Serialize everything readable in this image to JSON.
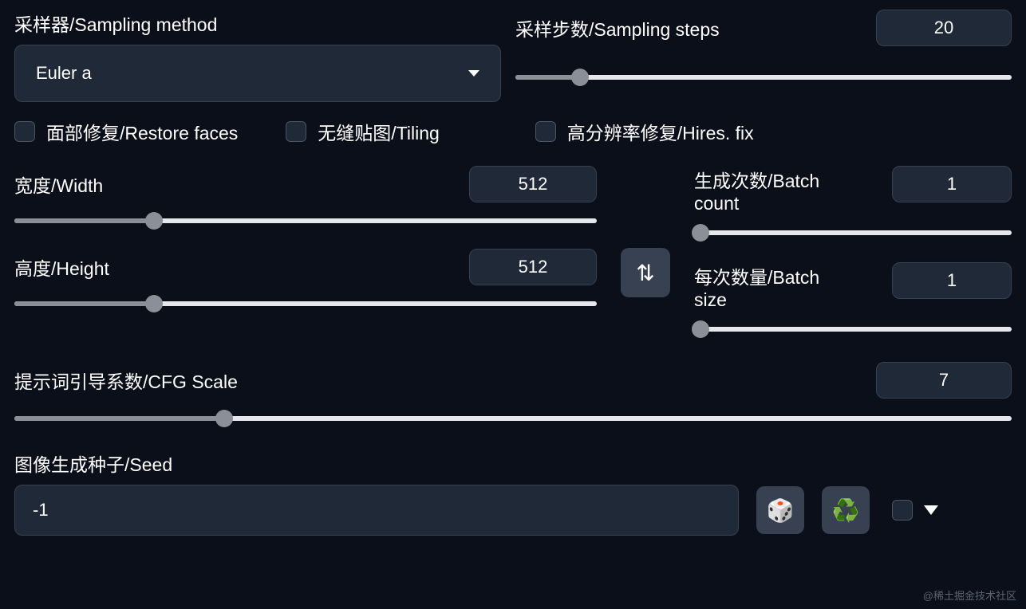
{
  "sampling_method": {
    "label": "采样器/Sampling method",
    "value": "Euler a"
  },
  "sampling_steps": {
    "label": "采样步数/Sampling steps",
    "value": "20",
    "fill_pct": 13
  },
  "restore_faces": {
    "label": "面部修复/Restore faces"
  },
  "tiling": {
    "label": "无缝贴图/Tiling"
  },
  "hires_fix": {
    "label": "高分辨率修复/Hires. fix"
  },
  "width": {
    "label": "宽度/Width",
    "value": "512",
    "fill_pct": 24
  },
  "height": {
    "label": "高度/Height",
    "value": "512",
    "fill_pct": 24
  },
  "batch_count": {
    "label": "生成次数/Batch count",
    "value": "1",
    "fill_pct": 2
  },
  "batch_size": {
    "label": "每次数量/Batch size",
    "value": "1",
    "fill_pct": 2
  },
  "cfg_scale": {
    "label": "提示词引导系数/CFG Scale",
    "value": "7",
    "fill_pct": 21
  },
  "seed": {
    "label": "图像生成种子/Seed",
    "value": "-1"
  },
  "icons": {
    "swap": "⇅",
    "dice": "🎲",
    "recycle": "♻️"
  },
  "watermark": "@稀土掘金技术社区"
}
